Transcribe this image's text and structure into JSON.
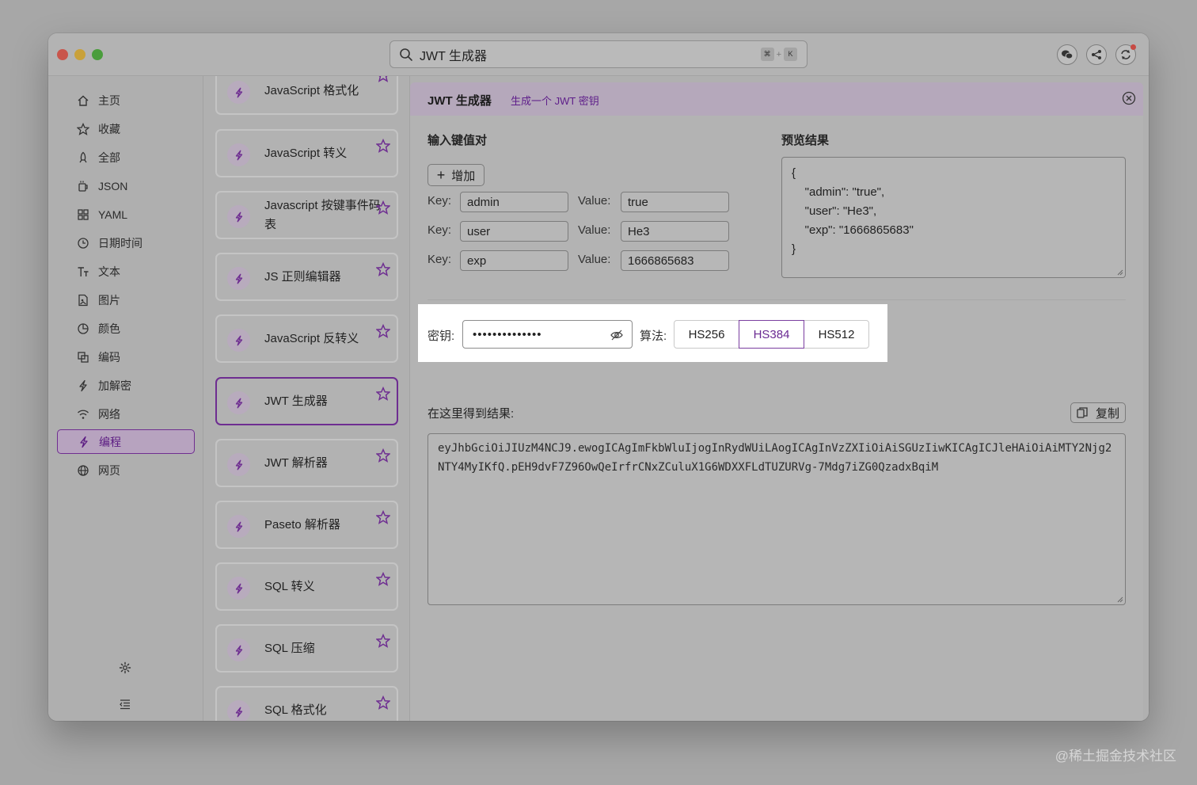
{
  "search": {
    "query": "JWT 生成器",
    "shortcut": [
      "⌘",
      "+",
      "K"
    ]
  },
  "sidebar": {
    "items": [
      {
        "label": "主页",
        "icon": "home-icon"
      },
      {
        "label": "收藏",
        "icon": "star-icon"
      },
      {
        "label": "全部",
        "icon": "rocket-icon"
      },
      {
        "label": "JSON",
        "icon": "cup-icon"
      },
      {
        "label": "YAML",
        "icon": "grid-icon"
      },
      {
        "label": "日期时间",
        "icon": "clock-icon"
      },
      {
        "label": "文本",
        "icon": "text-icon"
      },
      {
        "label": "图片",
        "icon": "file-image-icon"
      },
      {
        "label": "颜色",
        "icon": "pie-icon"
      },
      {
        "label": "编码",
        "icon": "copy-icon"
      },
      {
        "label": "加解密",
        "icon": "bolt-icon"
      },
      {
        "label": "网络",
        "icon": "wifi-icon"
      },
      {
        "label": "编程",
        "icon": "bolt-icon"
      },
      {
        "label": "网页",
        "icon": "globe-icon"
      }
    ],
    "active_index": 12
  },
  "tools": [
    {
      "name": "JavaScript 格式化"
    },
    {
      "name": "JavaScript 转义"
    },
    {
      "name": "Javascript 按键事件码表"
    },
    {
      "name": "JS 正则编辑器"
    },
    {
      "name": "JavaScript 反转义"
    },
    {
      "name": "JWT 生成器"
    },
    {
      "name": "JWT 解析器"
    },
    {
      "name": "Paseto 解析器"
    },
    {
      "name": "SQL 转义"
    },
    {
      "name": "SQL 压缩"
    },
    {
      "name": "SQL 格式化"
    }
  ],
  "active_tool_index": 5,
  "panel": {
    "title": "JWT 生成器",
    "subtitle": "生成一个 JWT 密钥",
    "kv_heading": "输入键值对",
    "add_label": "增加",
    "key_label": "Key:",
    "value_label": "Value:",
    "pairs": [
      {
        "key": "admin",
        "value": "true"
      },
      {
        "key": "user",
        "value": "He3"
      },
      {
        "key": "exp",
        "value": "1666865683"
      }
    ],
    "preview_heading": "预览结果",
    "preview_lines": [
      "{",
      "    \"admin\": \"true\",",
      "    \"user\": \"He3\",",
      "    \"exp\": \"1666865683\"",
      "}"
    ],
    "secret_label": "密钥:",
    "secret_masked": "••••••••••••••",
    "algo_label": "算法:",
    "algorithms": [
      "HS256",
      "HS384",
      "HS512"
    ],
    "selected_algorithm": "HS384",
    "result_label": "在这里得到结果:",
    "copy_label": "复制",
    "result_value": "eyJhbGciOiJIUzM4NCJ9.ewogICAgImFkbWluIjogInRydWUiLAogICAgInVzZXIiOiAiSGUzIiwKICAgICJleHAiOiAiMTY2Njg2NTY4MyIKfQ.pEH9dvF7Z96OwQeIrfrCNxZCuluX1G6WDXXFLdTUZURVg-7Mdg7iZG0QzadxBqiM"
  },
  "watermark": "@稀土掘金技术社区",
  "colors": {
    "accent": "#6e2d91",
    "header_bg": "#b5a8bb"
  }
}
